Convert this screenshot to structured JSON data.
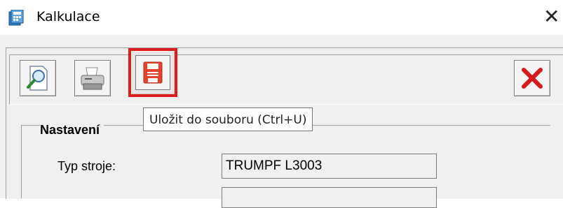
{
  "window": {
    "title": "Kalkulace",
    "close_glyph": "✕",
    "icon": "calculator-app-icon"
  },
  "toolbar": {
    "buttons": [
      {
        "name": "preview",
        "icon": "magnifier-page-icon"
      },
      {
        "name": "print",
        "icon": "printer-icon"
      },
      {
        "name": "save",
        "icon": "floppy-disk-icon",
        "highlighted": true,
        "highlight_color": "#e21b1b"
      },
      {
        "name": "close",
        "icon": "red-x-icon"
      }
    ],
    "tooltip": "Uložit do souboru (Ctrl+U)"
  },
  "settings": {
    "group_label": "Nastavení",
    "machine_type_label": "Typ stroje:",
    "machine_type_value": "TRUMPF L3003"
  },
  "colors": {
    "accent_red": "#e21b1b",
    "dialog_bg": "#f0f0f0"
  }
}
